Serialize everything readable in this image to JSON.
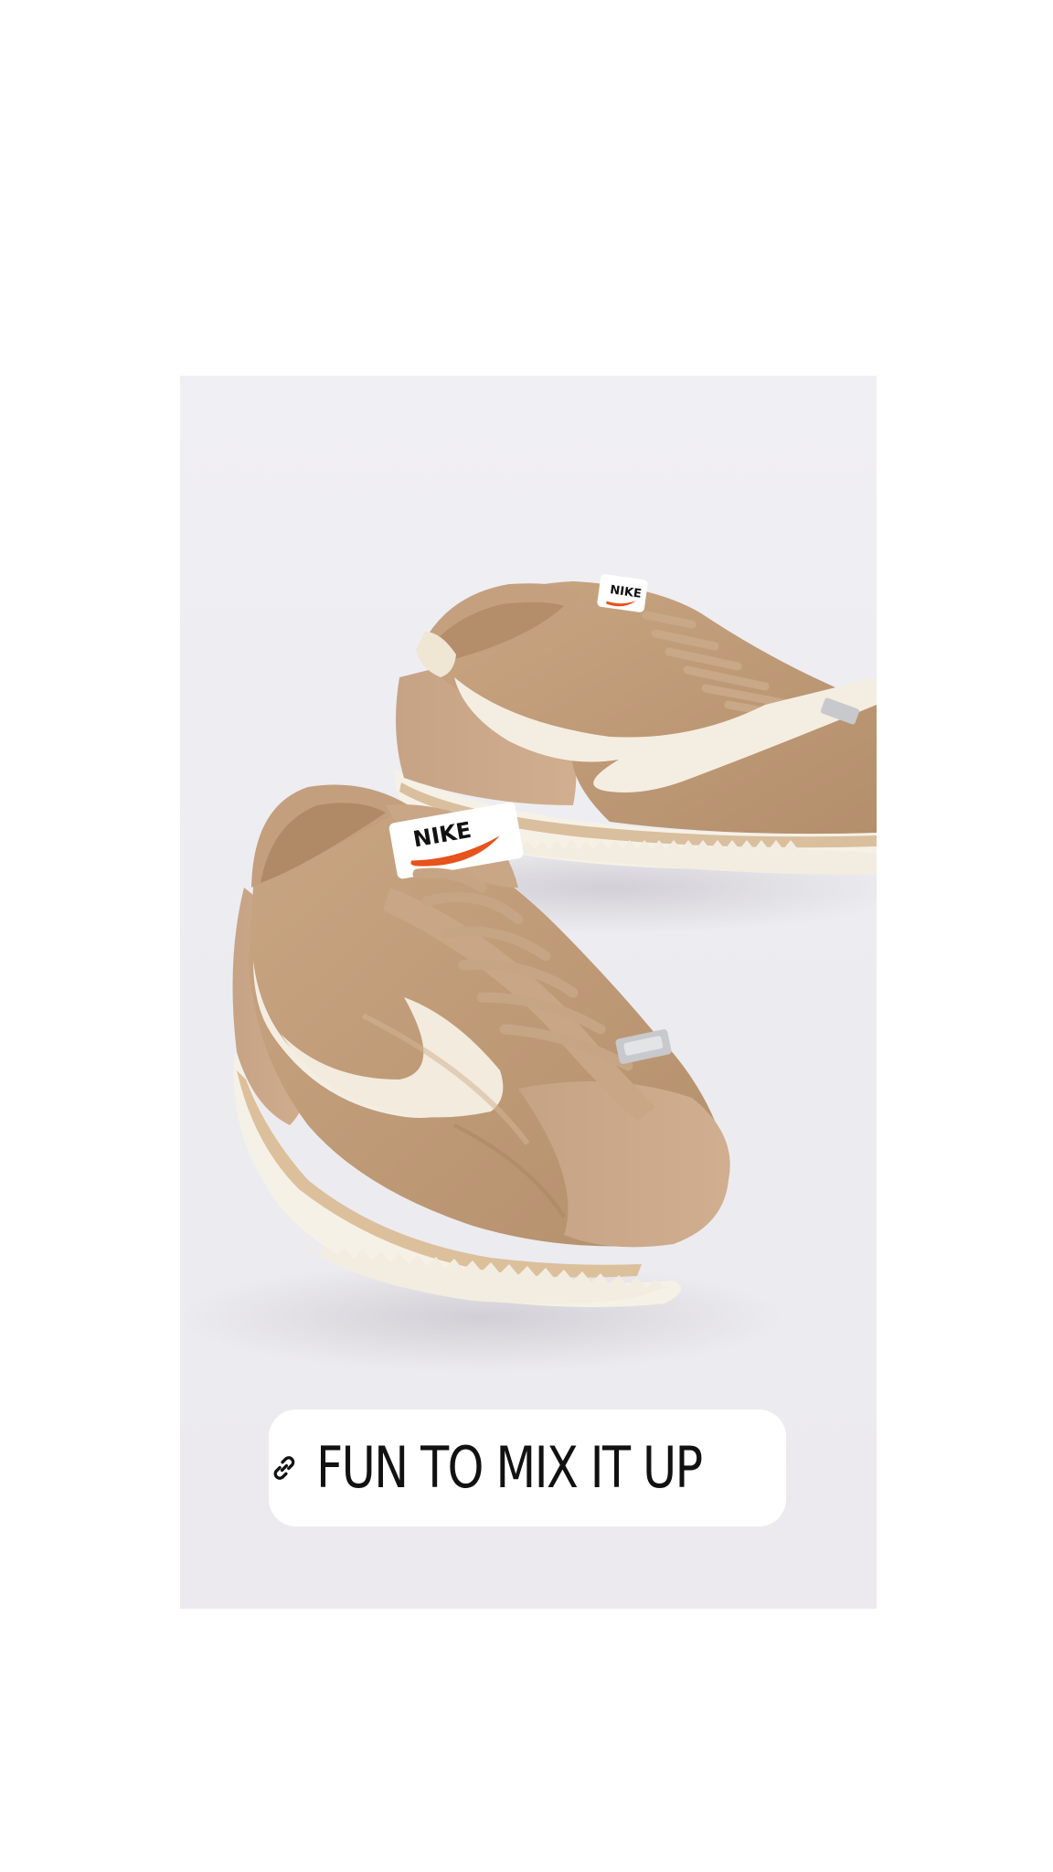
{
  "story": {
    "background_color": "#ffffff"
  },
  "product_photo": {
    "subject": "pair of tan nylon sneakers with cream swoosh and white sole",
    "brand_tag_text": "NIKE",
    "colors": {
      "upper": "#c19c7a",
      "suede": "#c6a283",
      "swoosh": "#f4eee2",
      "sole": "#f6f1e5",
      "backdrop": "#eeedf1"
    }
  },
  "link_sticker": {
    "icon": "link-icon",
    "label": "FUN TO MIX IT UP"
  }
}
